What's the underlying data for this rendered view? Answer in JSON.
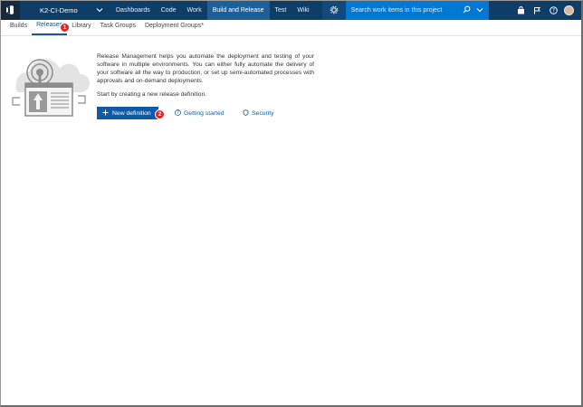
{
  "topbar": {
    "project": "K2-CI-Demo",
    "nav": [
      "Dashboards",
      "Code",
      "Work",
      "Build and Release",
      "Test",
      "Wiki"
    ],
    "active_nav_index": 3,
    "search_placeholder": "Search work items in this project"
  },
  "subnav": {
    "tabs": [
      "Builds",
      "Releases",
      "Library",
      "Task Groups",
      "Deployment Groups*"
    ],
    "active_tab_index": 1
  },
  "callouts": [
    "1",
    "2"
  ],
  "main": {
    "description": "Release Management helps you automate the deployment and testing of your software in multiple environments. You can either fully automate the delivery of your software all the way to production, or set up semi-automated processes with approvals and on-demand deployments.",
    "start_text": "Start by creating a new release definition.",
    "new_definition_label": "New definition",
    "getting_started_label": "Getting started",
    "security_label": "Security"
  },
  "colors": {
    "topbar": "#0e3d68",
    "search": "#0078d4",
    "primary_button": "#0e5aa7",
    "callout": "#d9262b"
  },
  "icons": {
    "logo": "vsts-logo-icon",
    "chevron": "chevron-down-icon",
    "settings": "gear-icon",
    "search": "search-icon",
    "marketplace": "shopping-bag-icon",
    "notifications": "flag-icon",
    "help": "question-icon",
    "user": "avatar"
  }
}
